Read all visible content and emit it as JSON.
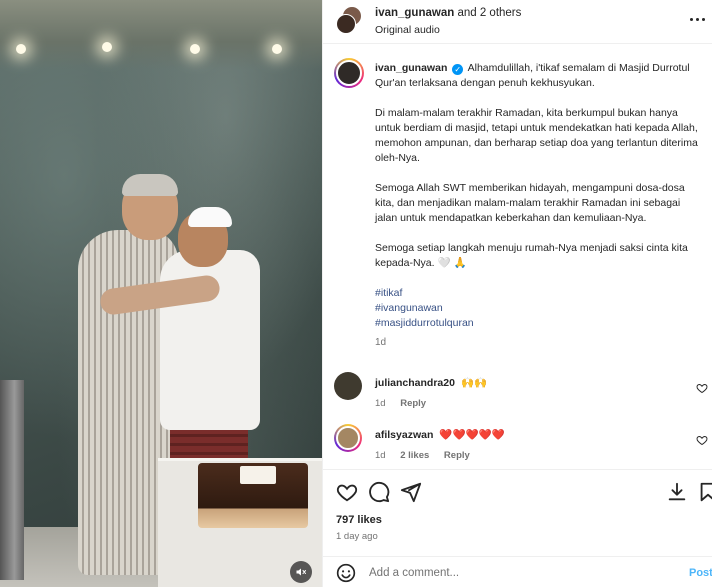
{
  "header": {
    "username": "ivan_gunawan",
    "others": "and 2 others",
    "audio": "Original audio"
  },
  "caption": {
    "username": "ivan_gunawan",
    "verified_mark": "✓",
    "paragraphs": [
      "Alhamdulillah, i'tikaf semalam di Masjid Durrotul Qur'an terlaksana dengan penuh kekhusyukan.",
      "Di malam-malam terakhir Ramadan, kita berkumpul bukan hanya untuk berdiam di masjid, tetapi untuk mendekatkan hati kepada Allah, memohon ampunan, dan berharap setiap doa yang terlantun diterima oleh-Nya.",
      "Semoga Allah SWT memberikan hidayah, mengampuni dosa-dosa kita, dan menjadikan malam-malam terakhir Ramadan ini sebagai jalan untuk mendapatkan keberkahan dan kemuliaan-Nya.",
      "Semoga setiap langkah menuju rumah-Nya menjadi saksi cinta kita kepada-Nya. 🤍 🙏"
    ],
    "hashtags": [
      "#itikaf",
      "#ivangunawan",
      "#masjiddurrotulquran"
    ],
    "time": "1d"
  },
  "comments": [
    {
      "username": "julianchandra20",
      "text": "🙌🙌",
      "time": "1d",
      "reply": "Reply",
      "likes": ""
    },
    {
      "username": "afilsyazwan",
      "text": "❤️❤️❤️❤️❤️",
      "time": "1d",
      "likes": "2 likes",
      "reply": "Reply"
    }
  ],
  "stats": {
    "likes": "797 likes",
    "posted": "1 day ago"
  },
  "add_comment": {
    "placeholder": "Add a comment...",
    "post_label": "Post"
  },
  "colors": {
    "link": "#385185",
    "verified": "#0095f6",
    "post_button": "#4cb5f9",
    "like_heart": "#ed4956"
  }
}
